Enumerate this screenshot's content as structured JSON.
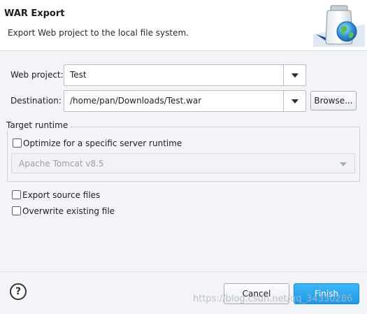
{
  "dialog": {
    "title": "WAR Export",
    "message": "Export Web project to the local file system."
  },
  "form": {
    "web_project_label": "Web project:",
    "web_project_value": "Test",
    "destination_label": "Destination:",
    "destination_value": "/home/pan/Downloads/Test.war",
    "browse_label": "Browse..."
  },
  "target_runtime": {
    "group_title": "Target runtime",
    "optimize_label": "Optimize for a specific server runtime",
    "optimize_checked": false,
    "runtime_value": "Apache Tomcat v8.5"
  },
  "options": {
    "export_source_label": "Export source files",
    "export_source_checked": false,
    "overwrite_label": "Overwrite existing file",
    "overwrite_checked": false
  },
  "footer": {
    "help_label": "?",
    "cancel_label": "Cancel",
    "finish_label": "Finish"
  },
  "watermark": "https://blog.csdn.net/qq_34330286",
  "colors": {
    "accent": "#1f9bea",
    "banner_bg": "#ffffff",
    "dialog_bg": "#f3f4f8"
  },
  "icons": {
    "banner": "war-export-jar-globe-icon",
    "help": "help-icon",
    "dropdown": "chevron-down-icon"
  }
}
